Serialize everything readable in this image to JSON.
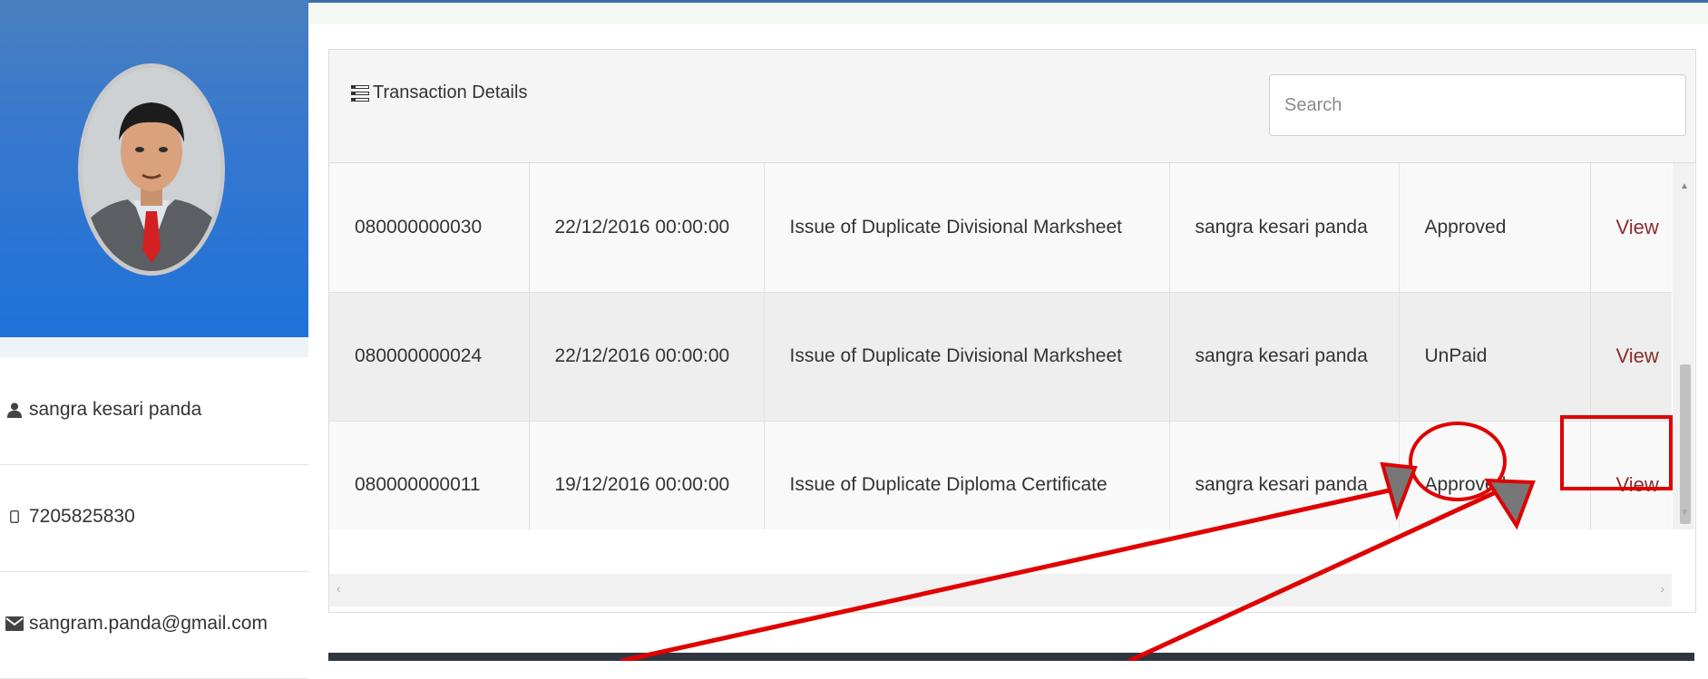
{
  "sidebar": {
    "user_name": "sangra kesari panda",
    "phone": "7205825830",
    "email": "sangram.panda@gmail.com",
    "icons": {
      "user": "user-icon",
      "phone": "mobile-phone-icon",
      "email": "envelope-icon"
    }
  },
  "panel": {
    "title": "Transaction Details",
    "title_icon": "table-list-icon",
    "search_placeholder": "Search"
  },
  "transactions": [
    {
      "id": "080000000030",
      "date": "22/12/2016 00:00:00",
      "service": "Issue of Duplicate Divisional Marksheet",
      "applicant": "sangra kesari panda",
      "status": "Approved",
      "action": "View"
    },
    {
      "id": "080000000024",
      "date": "22/12/2016 00:00:00",
      "service": "Issue of Duplicate Divisional Marksheet",
      "applicant": "sangra kesari panda",
      "status": "UnPaid",
      "action": "View"
    },
    {
      "id": "080000000011",
      "date": "19/12/2016 00:00:00",
      "service": "Issue of Duplicate Diploma Certificate",
      "applicant": "sangra kesari panda",
      "status": "Approved",
      "action": "View"
    }
  ],
  "colors": {
    "banner": "#1f72d8",
    "link": "#8b2c2c",
    "annotation": "#e00000"
  }
}
